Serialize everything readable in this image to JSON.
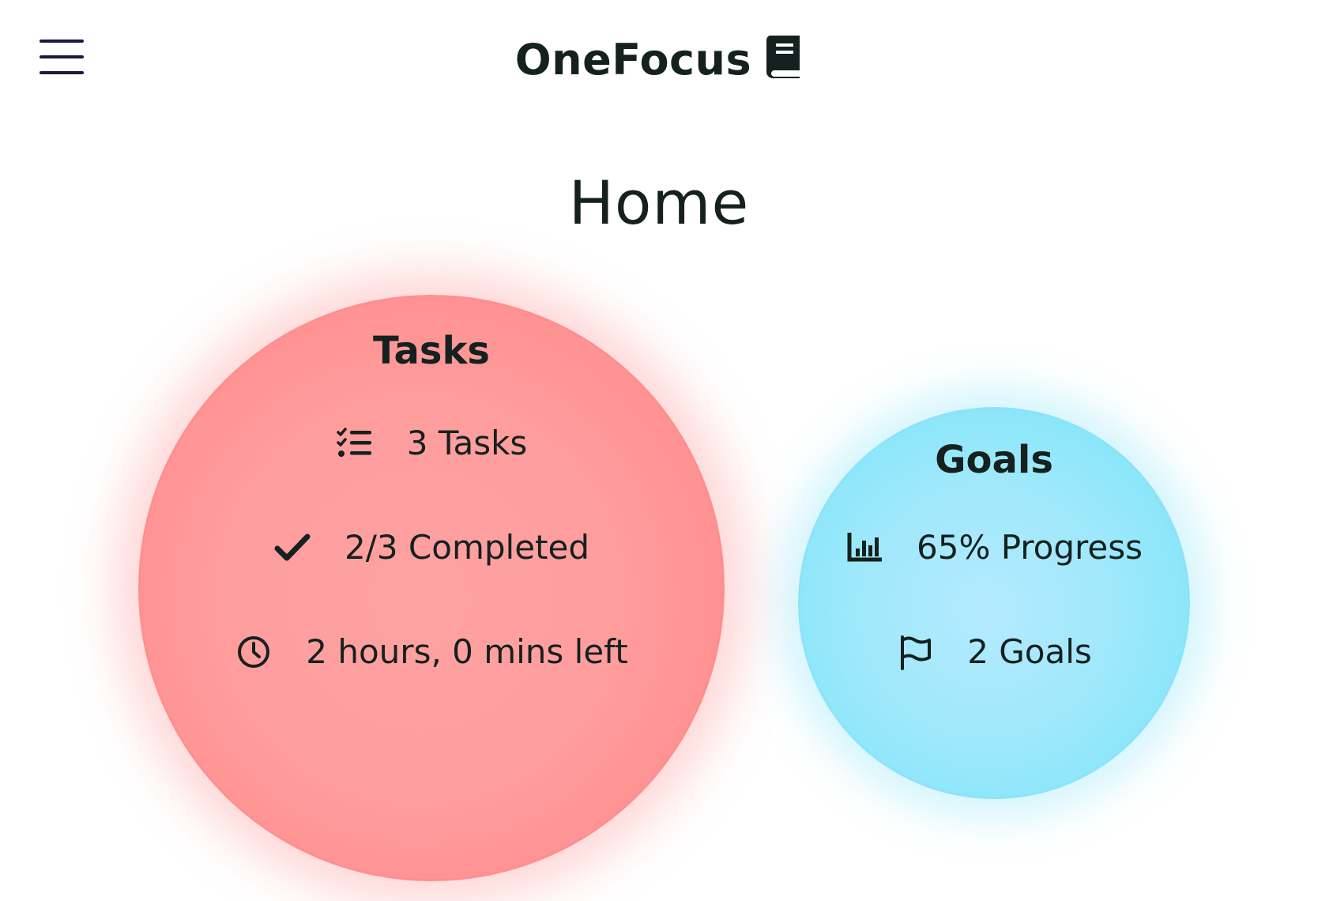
{
  "header": {
    "menu_icon": "hamburger-menu-icon",
    "brand": "OneFocus",
    "brand_icon": "book-icon"
  },
  "page": {
    "title": "Home"
  },
  "tasks_card": {
    "title": "Tasks",
    "color": "#ff9a9a",
    "items": [
      {
        "icon": "task-list-icon",
        "text": "3 Tasks"
      },
      {
        "icon": "checkmark-icon",
        "text": "2/3 Completed"
      },
      {
        "icon": "clock-icon",
        "text": "2 hours, 0 mins left"
      }
    ]
  },
  "goals_card": {
    "title": "Goals",
    "color": "#8fe6fb",
    "items": [
      {
        "icon": "bar-chart-icon",
        "text": "65% Progress"
      },
      {
        "icon": "flag-icon",
        "text": "2 Goals"
      }
    ]
  },
  "colors": {
    "text": "#14211f",
    "menu": "#1c1842"
  }
}
